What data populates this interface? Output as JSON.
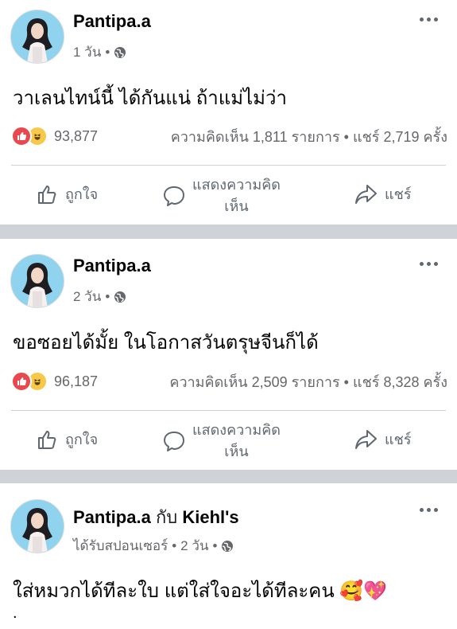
{
  "posts": [
    {
      "author": "Pantipa.a",
      "time": "1 วัน",
      "text": "วาเลนไทน์นี้ ได้กันแน่ ถ้าแม่ไม่ว่า",
      "reactions": "93,877",
      "comments": "ความคิดเห็น 1,811 รายการ",
      "shares": "แชร์ 2,719 ครั้ง"
    },
    {
      "author": "Pantipa.a",
      "time": "2 วัน",
      "text": "ขอซอยได้มั้ย ในโอกาสวันตรุษจีนก็ได้",
      "reactions": "96,187",
      "comments": "ความคิดเห็น 2,509 รายการ",
      "shares": "แชร์ 8,328 ครั้ง"
    },
    {
      "author": "Pantipa.a",
      "with_word": "กับ",
      "partner": "Kiehl's",
      "sponsored": "ได้รับสปอนเซอร์",
      "time": "2 วัน",
      "text": "ใส่หมวกได้ทีละใบ แต่ใส่ใจอะได้ทีละคน 🥰💖",
      "extra": "."
    }
  ],
  "actions": {
    "like": "ถูกใจ",
    "comment_line1": "แสดงความคิด",
    "comment_line2": "เห็น",
    "share": "แชร์"
  },
  "separator": "•",
  "icons": [
    "globe-icon",
    "more-options-icon",
    "like-reaction-icon",
    "haha-reaction-icon",
    "thumbs-up-icon",
    "comment-icon",
    "share-arrow-icon"
  ],
  "colors": {
    "divider": "#cfd2d6",
    "muted": "#65676b",
    "like_red": "#e9484e",
    "haha_yellow": "#f7c94b"
  }
}
